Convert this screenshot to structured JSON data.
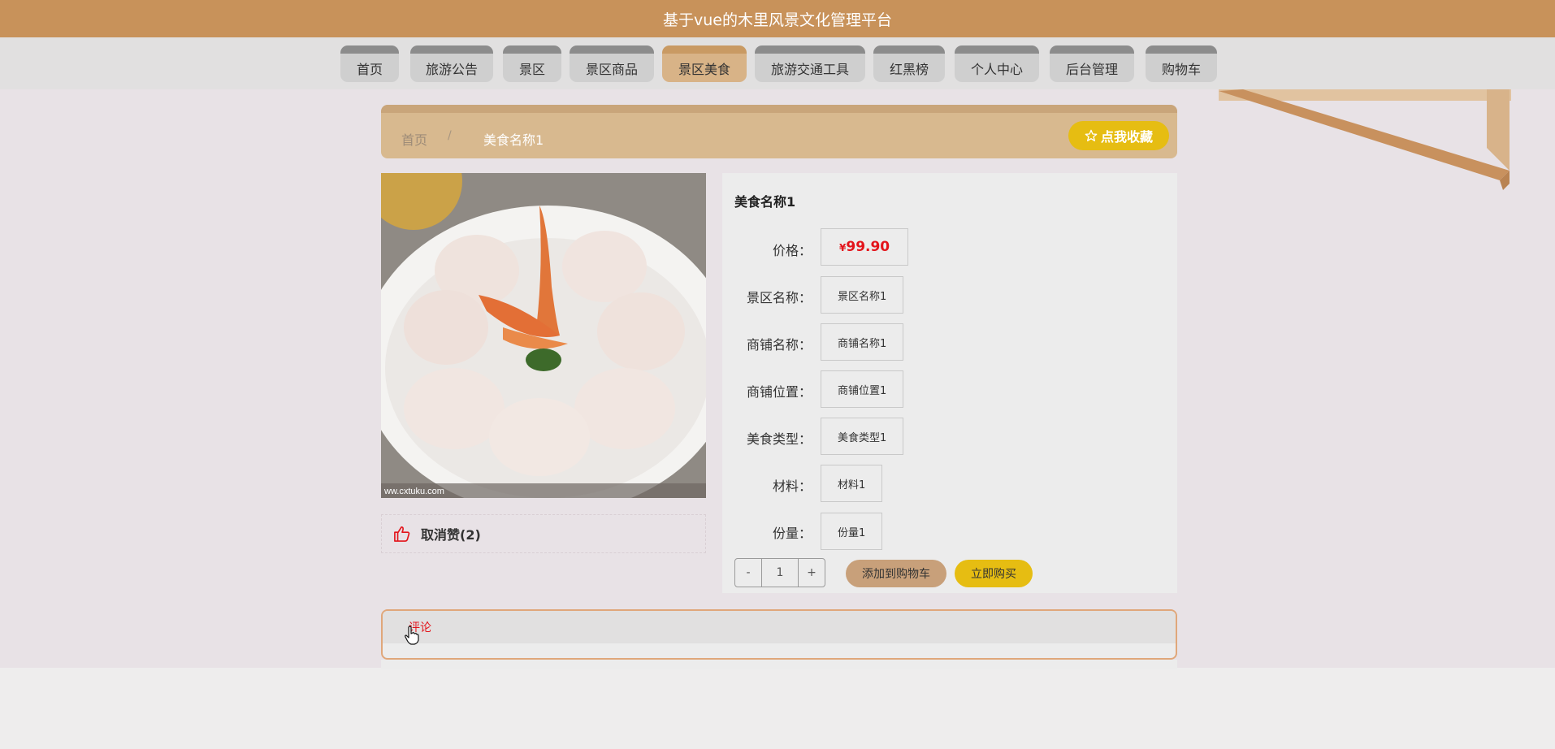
{
  "header": {
    "title": "基于vue的木里风景文化管理平台"
  },
  "nav": {
    "items": [
      {
        "label": "首页"
      },
      {
        "label": "旅游公告"
      },
      {
        "label": "景区"
      },
      {
        "label": "景区商品"
      },
      {
        "label": "景区美食",
        "active": true
      },
      {
        "label": "旅游交通工具"
      },
      {
        "label": "红黑榜"
      },
      {
        "label": "个人中心"
      },
      {
        "label": "后台管理"
      },
      {
        "label": "购物车"
      }
    ]
  },
  "breadcrumb": {
    "home": "首页",
    "separator": "/",
    "current": "美食名称1"
  },
  "favorite_button": {
    "label": "点我收藏",
    "icon": "star-outline-icon"
  },
  "like": {
    "icon": "thumbs-up-icon",
    "label": "取消赞(2)"
  },
  "detail": {
    "title": "美食名称1",
    "price_label": "价格：",
    "price_symbol": "¥",
    "price_value": "99.90",
    "rows": [
      {
        "label": "景区名称：",
        "value": "景区名称1"
      },
      {
        "label": "商铺名称：",
        "value": "商铺名称1"
      },
      {
        "label": "商铺位置：",
        "value": "商铺位置1"
      },
      {
        "label": "美食类型：",
        "value": "美食类型1"
      },
      {
        "label": "材料：",
        "value": "材料1"
      },
      {
        "label": "份量：",
        "value": "份量1"
      }
    ]
  },
  "stepper": {
    "minus": "-",
    "value": "1",
    "plus": "+"
  },
  "actions": {
    "add_to_cart": "添加到购物车",
    "buy_now": "立即购买"
  },
  "comments": {
    "tab_label": "评论"
  },
  "image_watermark": "ww.cxtuku.com",
  "colors": {
    "header": "#c8925a",
    "accent_yellow": "#e6bd12",
    "price_red": "#e3141b",
    "cart_tan": "#c8a07a"
  }
}
